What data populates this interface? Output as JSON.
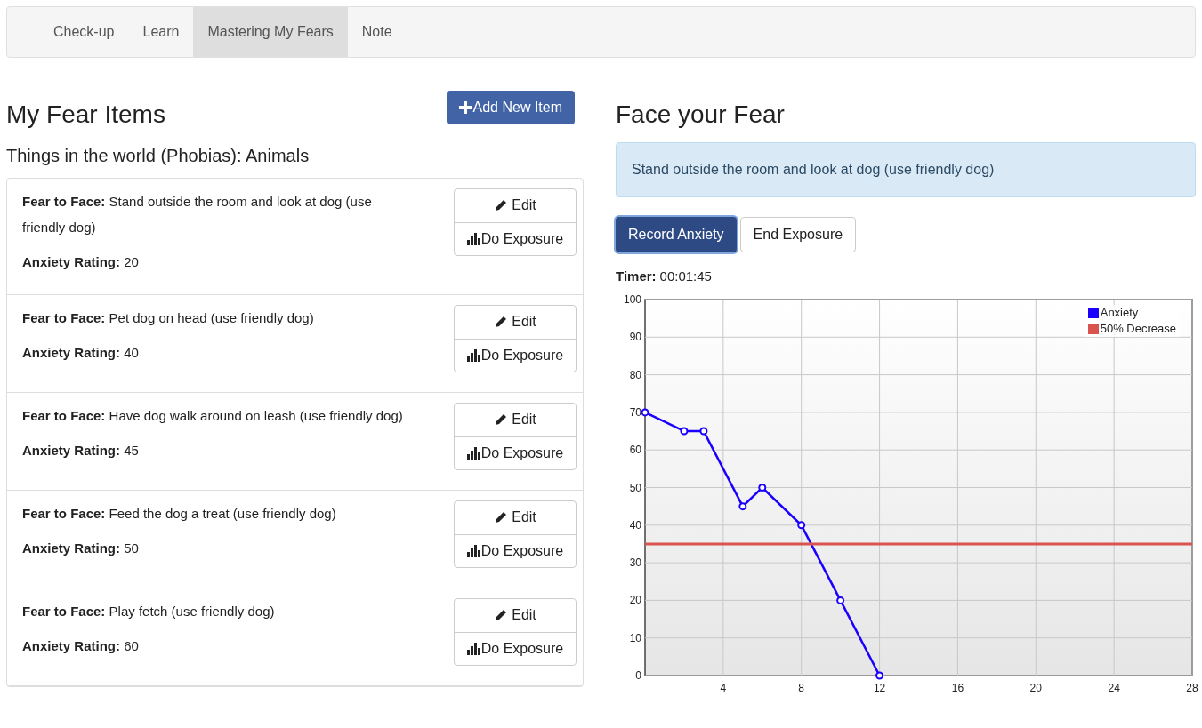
{
  "nav": {
    "tabs": [
      {
        "label": "Check-up",
        "selected": false
      },
      {
        "label": "Learn",
        "selected": false
      },
      {
        "label": "Mastering My Fears",
        "selected": true
      },
      {
        "label": "Note",
        "selected": false
      }
    ]
  },
  "fear_items": {
    "title": "My Fear Items",
    "add_button": "Add New Item",
    "category": "Things in the world (Phobias): Animals",
    "items": [
      {
        "fear": "**Fear to Face:** Stand outside the room and look at dog (use friendly dog)",
        "rating": "**Anxiety Rating:** 20",
        "edit": "Edit",
        "exposure": "Do Exposure"
      },
      {
        "fear": "**Fear to Face:** Pet dog on head (use friendly dog)",
        "rating": "**Anxiety Rating:** 40",
        "edit": "Edit",
        "exposure": "Do Exposure"
      },
      {
        "fear": "**Fear to Face:** Have dog walk around on leash (use friendly dog)",
        "rating": "**Anxiety Rating:** 45",
        "edit": "Edit",
        "exposure": "Do Exposure"
      },
      {
        "fear": "**Fear to Face:** Feed the dog a treat (use friendly dog)",
        "rating": "**Anxiety Rating:** 50",
        "edit": "Edit",
        "exposure": "Do Exposure"
      },
      {
        "fear": "**Fear to Face:** Play fetch (use friendly dog)",
        "rating": "**Anxiety Rating:** 60",
        "edit": "Edit",
        "exposure": "Do Exposure"
      }
    ]
  },
  "face_fear": {
    "title": "Face your Fear",
    "current_fear": "Stand outside the room and look at dog (use friendly dog)",
    "record_button": "Record Anxiety",
    "end_button": "End Exposure",
    "timer_label": "Timer:",
    "timer_value": "00:01:45",
    "chart_data": {
      "type": "line",
      "x": [
        0,
        2,
        3,
        5,
        6,
        8,
        10,
        12,
        28
      ],
      "series": [
        {
          "name": "Anxiety",
          "color": "#1a00ff",
          "marker": "circle",
          "values": [
            70,
            65,
            65,
            45,
            50,
            40,
            20,
            0,
            null
          ]
        },
        {
          "name": "50% Decrease",
          "color": "#d9534f",
          "values": [
            35,
            35,
            35,
            35,
            35,
            35,
            35,
            35,
            35
          ]
        }
      ],
      "grid": true,
      "legend": "top-right",
      "xlim": [
        0,
        28
      ],
      "ylim": [
        0,
        100
      ],
      "xticks": [
        4,
        8,
        12,
        16,
        20,
        24,
        28
      ],
      "yticks": [
        0,
        10,
        20,
        30,
        40,
        50,
        60,
        70,
        80,
        90,
        100
      ]
    }
  }
}
